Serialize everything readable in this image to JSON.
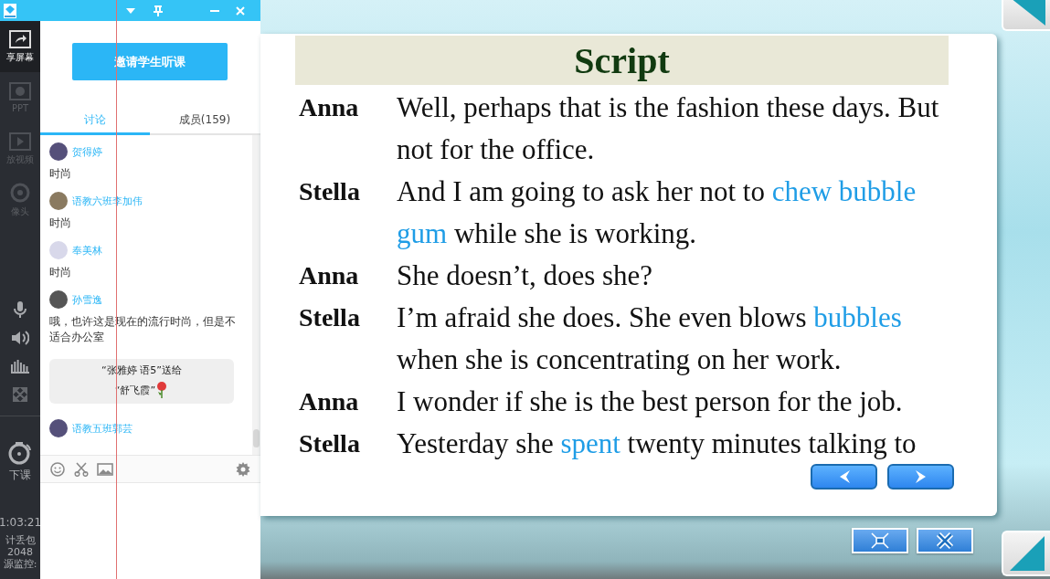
{
  "titlebar": {
    "buttons": [
      {
        "kind": "dropdown"
      },
      {
        "kind": "pin"
      },
      {
        "kind": "minimize"
      },
      {
        "kind": "close"
      }
    ]
  },
  "rail": {
    "items": [
      {
        "kind": "share",
        "label": "享屏幕",
        "selected": true
      },
      {
        "kind": "ppt",
        "label": "PPT",
        "selected": false
      },
      {
        "kind": "video",
        "label": "放视频",
        "selected": false
      },
      {
        "kind": "camera",
        "label": "像头",
        "selected": false
      }
    ],
    "controls": [
      {
        "kind": "mic"
      },
      {
        "kind": "speaker"
      },
      {
        "kind": "equalizer"
      },
      {
        "kind": "fullscreen"
      }
    ],
    "end_class": "下课",
    "timer": "1:03:21",
    "stats": [
      "计丢包",
      "2048",
      "源监控:"
    ]
  },
  "panel": {
    "invite_button": "邀请学生听课",
    "tabs": [
      {
        "label": "讨论",
        "selected": true
      },
      {
        "label": "成员(159)",
        "selected": false
      }
    ],
    "messages": [
      {
        "kind": "chat",
        "name": "贺得婷",
        "text": "时尚"
      },
      {
        "kind": "chat",
        "name": "语教六班李加伟",
        "text": "时尚"
      },
      {
        "kind": "chat",
        "name": "奉美林",
        "text": "时尚"
      },
      {
        "kind": "chat",
        "name": "孙雪逸",
        "text": "哦，也许这是现在的流行时尚，但是不适合办公室"
      },
      {
        "kind": "gift",
        "lines": [
          "“张雅婷 语5”送给",
          "“舒飞霞”"
        ]
      },
      {
        "kind": "chat",
        "name": "语教五班郭芸"
      }
    ],
    "tools": [
      {
        "kind": "emoji"
      },
      {
        "kind": "scissors"
      },
      {
        "kind": "image"
      },
      {
        "kind": "settings"
      }
    ]
  },
  "slide": {
    "title": "Script",
    "dialogue": [
      {
        "speaker": "Anna",
        "rows": [
          {
            "segments": [
              {
                "text": "Well, perhaps that is the fashion these days. But",
                "highlight": false
              }
            ]
          },
          {
            "segments": [
              {
                "text": "not for the office.",
                "highlight": false
              }
            ]
          }
        ]
      },
      {
        "speaker": "Stella",
        "rows": [
          {
            "segments": [
              {
                "text": "And I am going to ask her not to ",
                "highlight": false
              },
              {
                "text": "chew bubble",
                "highlight": true
              }
            ]
          },
          {
            "segments": [
              {
                "text": "gum",
                "highlight": true
              },
              {
                "text": " while she is working.",
                "highlight": false
              }
            ]
          }
        ]
      },
      {
        "speaker": "Anna",
        "rows": [
          {
            "segments": [
              {
                "text": "She doesn’t, does she?",
                "highlight": false
              }
            ]
          }
        ]
      },
      {
        "speaker": "Stella",
        "rows": [
          {
            "segments": [
              {
                "text": "I’m afraid she does. She even blows ",
                "highlight": false
              },
              {
                "text": "bubbles",
                "highlight": true
              }
            ]
          },
          {
            "segments": [
              {
                "text": "when she is concentrating on her work.",
                "highlight": false
              }
            ]
          }
        ]
      },
      {
        "speaker": "Anna",
        "rows": [
          {
            "segments": [
              {
                "text": "I wonder if she is the best person for the job.",
                "highlight": false
              }
            ]
          }
        ]
      },
      {
        "speaker": "Stella",
        "rows": [
          {
            "segments": [
              {
                "text": "Yesterday she ",
                "highlight": false
              },
              {
                "text": "spent",
                "highlight": true
              },
              {
                "text": " twenty minutes talking to",
                "highlight": false
              }
            ]
          }
        ]
      }
    ],
    "nav": [
      {
        "kind": "previous"
      },
      {
        "kind": "next"
      }
    ],
    "controls": [
      {
        "kind": "fit"
      },
      {
        "kind": "close"
      }
    ]
  }
}
